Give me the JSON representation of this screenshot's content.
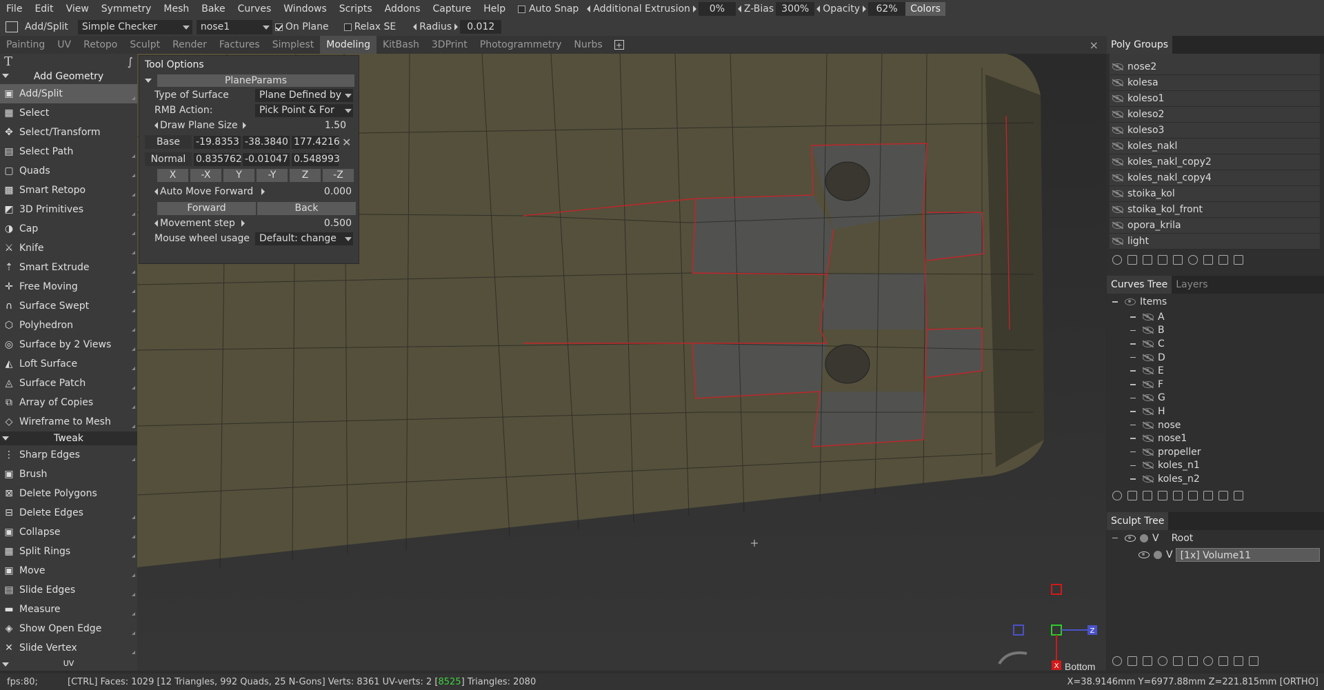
{
  "menu": {
    "items": [
      "File",
      "Edit",
      "View",
      "Symmetry",
      "Mesh",
      "Bake",
      "Curves",
      "Windows",
      "Scripts",
      "Addons",
      "Capture",
      "Help"
    ],
    "auto_snap": "Auto  Snap",
    "additional_extrusion": "Additional  Extrusion",
    "extrusion_value": "0%",
    "zbias_label": "Z-Bias",
    "zbias_value": "300%",
    "opacity_label": "Opacity",
    "opacity_value": "62%",
    "colors_btn": "Colors"
  },
  "toolrow": {
    "tool_name": "Add/Split",
    "shader": "Simple  Checker",
    "object": "nose1",
    "on_plane": "On  Plane",
    "relax": "Relax  SE",
    "radius_label": "Radius",
    "radius_value": "0.012"
  },
  "tabs": [
    "Painting",
    "UV",
    "Retopo",
    "Sculpt",
    "Render",
    "Factures",
    "Simplest",
    "Modeling",
    "KitBash",
    "3DPrint",
    "Photogrammetry",
    "Nurbs"
  ],
  "active_tab": "Modeling",
  "leftpanel": {
    "section1": "Add  Geometry",
    "section2": "Tweak",
    "section3": "UV",
    "tools1": [
      {
        "label": "Add/Split",
        "icon": "add-split-icon",
        "glyph": "▣"
      },
      {
        "label": "Select",
        "icon": "select-icon",
        "glyph": "▦"
      },
      {
        "label": "Select/Transform",
        "icon": "transform-icon",
        "glyph": "✥"
      },
      {
        "label": "Select  Path",
        "icon": "path-icon",
        "glyph": "▤"
      },
      {
        "label": "Quads",
        "icon": "quads-icon",
        "glyph": "▢"
      },
      {
        "label": "Smart  Retopo",
        "icon": "retopo-icon",
        "glyph": "▩"
      },
      {
        "label": "3D  Primitives",
        "icon": "primitives-icon",
        "glyph": "◩"
      },
      {
        "label": "Cap",
        "icon": "cap-icon",
        "glyph": "◑"
      },
      {
        "label": "Knife",
        "icon": "knife-icon",
        "glyph": "⚔"
      },
      {
        "label": "Smart  Extrude",
        "icon": "extrude-icon",
        "glyph": "⇡"
      },
      {
        "label": "Free  Moving",
        "icon": "free-moving-icon",
        "glyph": "✛"
      },
      {
        "label": "Surface  Swept",
        "icon": "swept-icon",
        "glyph": "∩"
      },
      {
        "label": "Polyhedron",
        "icon": "polyhedron-icon",
        "glyph": "⬡"
      },
      {
        "label": "Surface  by  2  Views",
        "icon": "two-views-icon",
        "glyph": "◎"
      },
      {
        "label": "Loft  Surface",
        "icon": "loft-icon",
        "glyph": "◭"
      },
      {
        "label": "Surface  Patch",
        "icon": "patch-icon",
        "glyph": "◬"
      },
      {
        "label": "Array  of  Copies",
        "icon": "array-icon",
        "glyph": "⧉"
      },
      {
        "label": "Wireframe  to  Mesh",
        "icon": "wireframe-icon",
        "glyph": "◇"
      }
    ],
    "tools2": [
      {
        "label": "Sharp  Edges",
        "icon": "sharp-edges-icon",
        "glyph": "⋮"
      },
      {
        "label": "Brush",
        "icon": "brush-icon",
        "glyph": "▣"
      },
      {
        "label": "Delete  Polygons",
        "icon": "delete-polygons-icon",
        "glyph": "⊠"
      },
      {
        "label": "Delete  Edges",
        "icon": "delete-edges-icon",
        "glyph": "⊟"
      },
      {
        "label": "Collapse",
        "icon": "collapse-icon",
        "glyph": "▣"
      },
      {
        "label": "Split  Rings",
        "icon": "split-rings-icon",
        "glyph": "▦"
      },
      {
        "label": "Move",
        "icon": "move-icon",
        "glyph": "▣"
      },
      {
        "label": "Slide  Edges",
        "icon": "slide-edges-icon",
        "glyph": "▤"
      },
      {
        "label": "Measure",
        "icon": "measure-icon",
        "glyph": "▬"
      },
      {
        "label": "Show  Open  Edge",
        "icon": "open-edge-icon",
        "glyph": "◈"
      },
      {
        "label": "Slide  Vertex",
        "icon": "slide-vertex-icon",
        "glyph": "✕"
      }
    ]
  },
  "tool_options": {
    "title": "Tool  Options",
    "group": "PlaneParams",
    "type_label": "Type  of  Surface",
    "type_value": "Plane  Defined  by",
    "rmb_label": "RMB  Action:",
    "rmb_value": "Pick  Point  &  For",
    "draw_size_label": "Draw  Plane  Size",
    "draw_size_value": "1.50",
    "base_label": "Base",
    "base": [
      "-19.8353",
      "-38.3840",
      "177.4216"
    ],
    "normal_label": "Normal",
    "normal": [
      "0.835762",
      "-0.01047",
      "0.548993"
    ],
    "axis_btns": [
      "X",
      "-X",
      "Y",
      "-Y",
      "Z",
      "-Z"
    ],
    "auto_move_label": "Auto  Move  Forward",
    "auto_move_value": "0.000",
    "forward_btn": "Forward",
    "back_btn": "Back",
    "movement_label": "Movement  step",
    "movement_value": "0.500",
    "wheel_label": "Mouse  wheel  usage",
    "wheel_value": "Default:  change"
  },
  "polygroups": {
    "title": "Poly  Groups",
    "items": [
      "nose2",
      "kolesa",
      "koleso1",
      "koleso2",
      "koleso3",
      "koles_nakl",
      "koles_nakl_copy2",
      "koles_nakl_copy4",
      "stoika_kol",
      "stoika_kol_front",
      "opora_krila",
      "light"
    ]
  },
  "curves": {
    "tab_active": "Curves  Tree",
    "tab_inactive": "Layers",
    "root": "Items",
    "items": [
      "A",
      "B",
      "C",
      "D",
      "E",
      "F",
      "G",
      "H",
      "nose",
      "nose1",
      "propeller",
      "koles_n1",
      "koles_n2"
    ]
  },
  "sculpt": {
    "title": "Sculpt  Tree",
    "root": "Root",
    "root_v": "V",
    "item_v": "V",
    "item": "[1x]  Volume11"
  },
  "viewport": {
    "view_label": "Bottom",
    "gizmo_z": "Z",
    "gizmo_x": "X"
  },
  "status": {
    "fps": "fps:80;",
    "faces": "[CTRL]  Faces:  1029  [12  Triangles,  992  Quads,  25  N-Gons]  Verts:  8361   UV-verts:  2  [",
    "uv_highlight": "8525",
    "triangles": "]  Triangles:  2080",
    "coords": "X=38.9146mm   Y=6977.88mm   Z=221.815mm  [ORTHO]"
  },
  "colors": {
    "mesh": "#54503b",
    "selected_face": "#4f5460",
    "red_edge": "#c0252b",
    "gizmo_green": "#2ecc2e",
    "gizmo_blue": "#4a52c8",
    "gizmo_red": "#d21a1a"
  }
}
